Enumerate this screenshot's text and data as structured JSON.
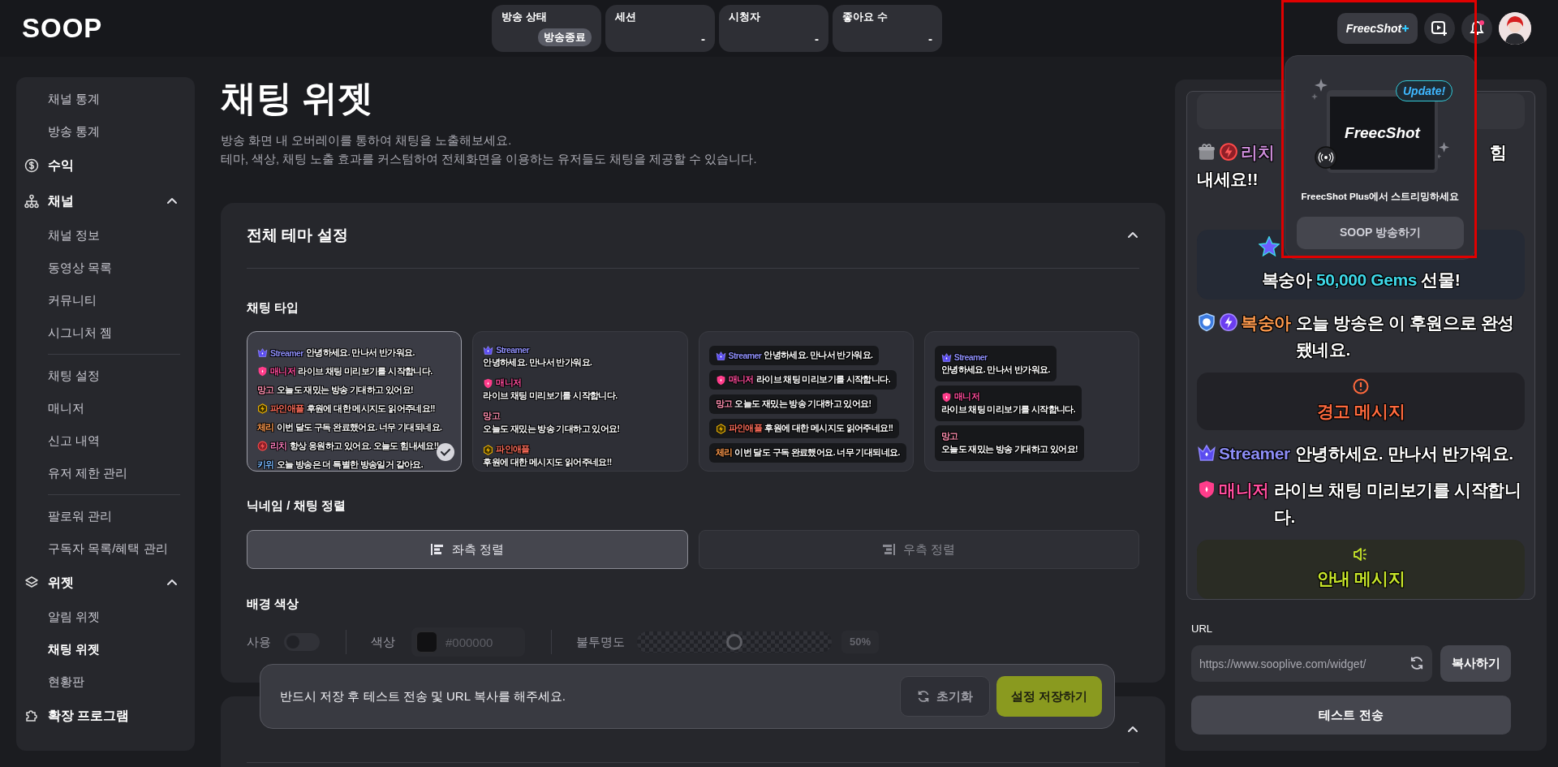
{
  "logo": "SOOP",
  "stats": [
    {
      "label": "방송 상태",
      "value": "방송종료",
      "kind": "badge"
    },
    {
      "label": "세션",
      "value": "-",
      "kind": "plain"
    },
    {
      "label": "시청자",
      "value": "-",
      "kind": "plain"
    },
    {
      "label": "좋아요 수",
      "value": "-",
      "kind": "plain"
    }
  ],
  "header_actions": {
    "freecshot_label": "FreecShot",
    "notification_unread": true
  },
  "popover": {
    "badge": "Update!",
    "logo": "FreecShot",
    "message": "FreecShot Plus에서 스트리밍하세요",
    "button": "SOOP 방송하기"
  },
  "sidebar": {
    "items": [
      {
        "kind": "link",
        "label": "채널 통계",
        "selected": false
      },
      {
        "kind": "link",
        "label": "방송 통계",
        "selected": false
      },
      {
        "kind": "section",
        "label": "수익",
        "selected": false
      },
      {
        "kind": "group",
        "label": "채널",
        "expanded": true,
        "children": [
          {
            "kind": "link",
            "label": "채널 정보",
            "selected": false
          },
          {
            "kind": "link",
            "label": "동영상 목록",
            "selected": false
          },
          {
            "kind": "link",
            "label": "커뮤니티",
            "selected": false
          },
          {
            "kind": "link",
            "label": "시그니처 젬",
            "selected": false
          },
          {
            "kind": "divider"
          },
          {
            "kind": "link",
            "label": "채팅 설정",
            "selected": false
          },
          {
            "kind": "link",
            "label": "매니저",
            "selected": false
          },
          {
            "kind": "link",
            "label": "신고 내역",
            "selected": false
          },
          {
            "kind": "link",
            "label": "유저 제한 관리",
            "selected": false
          },
          {
            "kind": "divider"
          },
          {
            "kind": "link",
            "label": "팔로워 관리",
            "selected": false
          },
          {
            "kind": "link",
            "label": "구독자 목록/혜택 관리",
            "selected": false
          }
        ]
      },
      {
        "kind": "group",
        "label": "위젯",
        "expanded": true,
        "children": [
          {
            "kind": "link",
            "label": "알림 위젯",
            "selected": false
          },
          {
            "kind": "link",
            "label": "채팅 위젯",
            "selected": true
          },
          {
            "kind": "link",
            "label": "현황판",
            "selected": false
          }
        ]
      },
      {
        "kind": "section",
        "label": "확장 프로그램",
        "selected": false
      }
    ]
  },
  "page": {
    "title": "채팅 위젯",
    "description": [
      "방송 화면 내 오버레이를 통하여 채팅을 노출해보세요.",
      "테마, 색상, 채팅 노출 효과를 커스텀하여 전체화면을 이용하는 유저들도 채팅을 제공할 수 있습니다."
    ]
  },
  "theme_section": {
    "title": "전체 테마 설정",
    "expanded": true,
    "chat_type": {
      "label": "채팅 타입",
      "options": [
        {
          "kind": "inline",
          "selected": true,
          "messages": [
            {
              "kind": "streamer",
              "name": "Streamer",
              "color": "#8c8cf5",
              "text": "안녕하세요. 만나서 반가워요."
            },
            {
              "kind": "manager",
              "name": "매니저",
              "color": "#ff4d9d",
              "text": "라이브 채팅 미리보기를 시작합니다."
            },
            {
              "kind": "plain",
              "name": "망고",
              "color": "#ff8fb0",
              "text": "오늘도 재밌는 방송 기대하고 있어요!"
            },
            {
              "kind": "fan",
              "name": "파인애플",
              "color": "#ff6d5a",
              "text": "후원에 대한 메시지도 읽어주네요!!"
            },
            {
              "kind": "plain",
              "name": "체리",
              "color": "#ff9a4d",
              "text": "이번 달도 구독 완료했어요. 너무 기대되네요."
            },
            {
              "kind": "vip",
              "name": "리치",
              "color": "#ff80c0",
              "text": "항상 응원하고 있어요. 오늘도 힘내세요!!"
            },
            {
              "kind": "plain",
              "name": "키위",
              "color": "#78b8ff",
              "text": "오늘 방송은 더 특별한 방송일거 같아요."
            }
          ]
        },
        {
          "kind": "stacked",
          "selected": false,
          "messages": [
            {
              "kind": "streamer",
              "name": "Streamer",
              "color": "#8c8cf5",
              "text": "안녕하세요. 만나서 반가워요."
            },
            {
              "kind": "manager",
              "name": "매니저",
              "color": "#ff4d9d",
              "text": "라이브 채팅 미리보기를 시작합니다."
            },
            {
              "kind": "plain",
              "name": "망고",
              "color": "#ff8fb0",
              "text": "오늘도 재밌는 방송 기대하고 있어요!"
            },
            {
              "kind": "fan",
              "name": "파인애플",
              "color": "#ff6d5a",
              "text": "후원에 대한 메시지도 읽어주네요!!"
            }
          ]
        },
        {
          "kind": "bubble-inline",
          "selected": false,
          "messages": [
            {
              "kind": "streamer",
              "name": "Streamer",
              "color": "#8c8cf5",
              "text": "안녕하세요. 만나서 반가워요."
            },
            {
              "kind": "manager",
              "name": "매니저",
              "color": "#ff4d9d",
              "text": "라이브 채팅 미리보기를 시작합니다."
            },
            {
              "kind": "plain",
              "name": "망고",
              "color": "#ff8fb0",
              "text": "오늘도 재밌는 방송 기대하고 있어요!"
            },
            {
              "kind": "fan",
              "name": "파인애플",
              "color": "#ff6d5a",
              "text": "후원에 대한 메시지도 읽어주네요!!"
            },
            {
              "kind": "plain",
              "name": "체리",
              "color": "#ff9a4d",
              "text": "이번 달도 구독 완료했어요. 너무 기대되네요."
            }
          ]
        },
        {
          "kind": "bubble-stacked",
          "selected": false,
          "messages": [
            {
              "kind": "streamer",
              "name": "Streamer",
              "color": "#8c8cf5",
              "text": "안녕하세요. 만나서 반가워요."
            },
            {
              "kind": "manager",
              "name": "매니저",
              "color": "#ff4d9d",
              "text": "라이브 채팅 미리보기를 시작합니다."
            },
            {
              "kind": "plain",
              "name": "망고",
              "color": "#ff8fb0",
              "text": "오늘도 재밌는 방송 기대하고 있어요!"
            }
          ]
        }
      ]
    },
    "alignment": {
      "label": "닉네임 / 채팅 정렬",
      "options": [
        {
          "kind": "left",
          "label": "좌측 정렬",
          "selected": true
        },
        {
          "kind": "right",
          "label": "우측 정렬",
          "selected": false
        }
      ]
    },
    "background": {
      "label": "배경 색상",
      "use_label": "사용",
      "on": false,
      "color_label": "색상",
      "color_value": "#000000",
      "opacity_label": "불투명도",
      "level": 0.5,
      "reading": "50%"
    }
  },
  "next_section": {
    "expanded": true
  },
  "toast": {
    "message": "반드시 저장 후 테스트 전송 및 URL 복사를 해주세요.",
    "reset": "초기화",
    "save": "설정 저장하기"
  },
  "preview": {
    "items": [
      {
        "kind": "cut-box"
      },
      {
        "kind": "chat",
        "badges": [
          {
            "kind": "subscriber"
          },
          {
            "kind": "vip"
          }
        ],
        "name": "리치",
        "color": "#c98ad6",
        "fragment": "힘",
        "text": "내세요!!"
      },
      {
        "kind": "gift",
        "name": "복숭아",
        "amount": "50,000 Gems",
        "text": "선물!"
      },
      {
        "kind": "chat",
        "badges": [
          {
            "kind": "tier"
          },
          {
            "kind": "supporter"
          }
        ],
        "name": "복숭아",
        "color": "#ff9a4d",
        "text": "오늘 방송은 이 후원으로 완성 됐네요."
      },
      {
        "kind": "warning",
        "text": "경고 메시지"
      },
      {
        "kind": "chat",
        "badges": [
          {
            "kind": "streamer"
          }
        ],
        "name": "Streamer",
        "color": "#8c8cf5",
        "text": "안녕하세요. 만나서 반가워요."
      },
      {
        "kind": "chat",
        "badges": [
          {
            "kind": "manager"
          }
        ],
        "name": "매니저",
        "color": "#ff4d9d",
        "text": "라이브 채팅 미리보기를 시작합니다."
      },
      {
        "kind": "notice",
        "text": "안내 메시지"
      }
    ]
  },
  "url": {
    "label": "URL",
    "value": "https://www.sooplive.com/widget/",
    "copy": "복사하기"
  },
  "test_button": "테스트 전송"
}
